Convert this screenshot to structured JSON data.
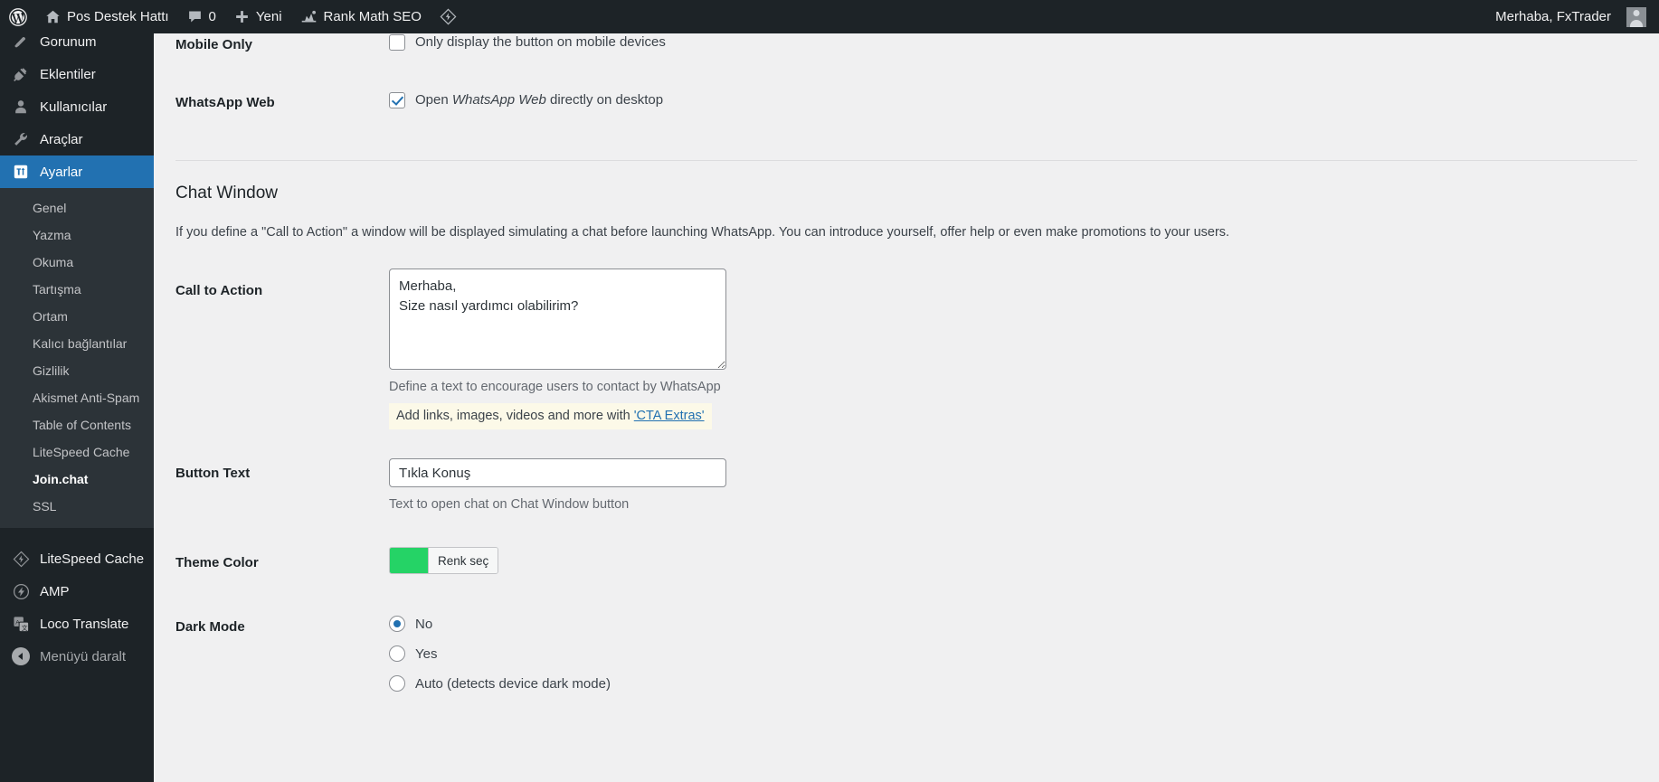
{
  "adminbar": {
    "wp_logo": "wordpress-logo-icon",
    "site_name": "Pos Destek Hattı",
    "comments_count": "0",
    "new_label": "Yeni",
    "rankmath_label": "Rank Math SEO",
    "howdy": "Merhaba, FxTrader"
  },
  "sidebar": {
    "items": [
      {
        "label": "Gorunum",
        "icon": "appearance-icon",
        "current": false
      },
      {
        "label": "Eklentiler",
        "icon": "plugins-icon",
        "current": false
      },
      {
        "label": "Kullanıcılar",
        "icon": "users-icon",
        "current": false
      },
      {
        "label": "Araçlar",
        "icon": "tools-icon",
        "current": false
      },
      {
        "label": "Ayarlar",
        "icon": "settings-icon",
        "current": true
      }
    ],
    "submenu": [
      {
        "label": "Genel",
        "current": false
      },
      {
        "label": "Yazma",
        "current": false
      },
      {
        "label": "Okuma",
        "current": false
      },
      {
        "label": "Tartışma",
        "current": false
      },
      {
        "label": "Ortam",
        "current": false
      },
      {
        "label": "Kalıcı bağlantılar",
        "current": false
      },
      {
        "label": "Gizlilik",
        "current": false
      },
      {
        "label": "Akismet Anti-Spam",
        "current": false
      },
      {
        "label": "Table of Contents",
        "current": false
      },
      {
        "label": "LiteSpeed Cache",
        "current": false
      },
      {
        "label": "Join.chat",
        "current": true
      },
      {
        "label": "SSL",
        "current": false
      }
    ],
    "bottom_items": [
      {
        "label": "LiteSpeed Cache",
        "icon": "litespeed-icon"
      },
      {
        "label": "AMP",
        "icon": "amp-icon"
      },
      {
        "label": "Loco Translate",
        "icon": "translate-icon"
      }
    ],
    "collapse_label": "Menüyü daralt"
  },
  "main": {
    "mobile_only": {
      "label": "Mobile Only",
      "checkbox_label": "Only display the button on mobile devices",
      "checked": false
    },
    "whatsapp_web": {
      "label": "WhatsApp Web",
      "checkbox_label_pre": "Open ",
      "checkbox_label_em": "WhatsApp Web",
      "checkbox_label_post": " directly on desktop",
      "checked": true
    },
    "chat_window": {
      "title": "Chat Window",
      "description": "If you define a \"Call to Action\" a window will be displayed simulating a chat before launching WhatsApp. You can introduce yourself, offer help or even make promotions to your users."
    },
    "call_to_action": {
      "label": "Call to Action",
      "value": "Merhaba,\nSize nasıl yardımcı olabilirim?",
      "help": "Define a text to encourage users to contact by WhatsApp",
      "notice_text": "Add links, images, videos and more with ",
      "notice_link": "'CTA Extras'"
    },
    "button_text": {
      "label": "Button Text",
      "value": "Tıkla Konuş",
      "help": "Text to open chat on Chat Window button"
    },
    "theme_color": {
      "label": "Theme Color",
      "swatch_hex": "#25D366",
      "button_label": "Renk seç"
    },
    "dark_mode": {
      "label": "Dark Mode",
      "options": [
        {
          "label": "No",
          "checked": true
        },
        {
          "label": "Yes",
          "checked": false
        },
        {
          "label": "Auto (detects device dark mode)",
          "checked": false
        }
      ]
    }
  }
}
